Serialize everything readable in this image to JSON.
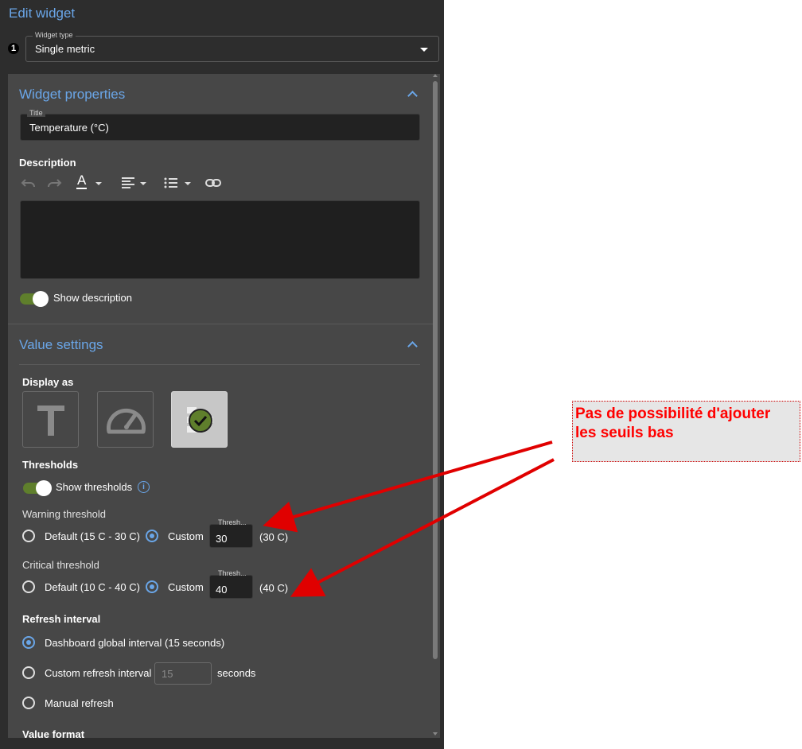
{
  "header": {
    "title": "Edit widget",
    "step_number": "1"
  },
  "widget_type": {
    "label": "Widget type",
    "value": "Single metric"
  },
  "widget_properties": {
    "title": "Widget properties",
    "title_field": {
      "label": "Title",
      "value": "Temperature (°C)"
    },
    "description_label": "Description",
    "toolbar": {
      "undo_icon": "undo-icon",
      "redo_icon": "redo-icon",
      "text_color_glyph": "A",
      "align_icon": "align-left-icon",
      "list_icon": "bulleted-list-icon",
      "link_icon": "link-icon"
    },
    "show_description_label": "Show description",
    "show_description_on": true
  },
  "value_settings": {
    "title": "Value settings",
    "display_as_label": "Display as",
    "display_options": [
      {
        "icon": "text-icon",
        "glyph": "T",
        "selected": false
      },
      {
        "icon": "gauge-icon",
        "selected": false
      },
      {
        "icon": "status-check-icon",
        "selected": true
      }
    ],
    "thresholds_label": "Thresholds",
    "show_thresholds_label": "Show thresholds",
    "show_thresholds_on": true,
    "warning": {
      "label": "Warning threshold",
      "default_label": "Default (15 C - 30 C)",
      "custom_label": "Custom",
      "field_label": "Thresh...",
      "value": "30",
      "unit_label": "(30 C)",
      "selected": "custom"
    },
    "critical": {
      "label": "Critical threshold",
      "default_label": "Default (10 C - 40 C)",
      "custom_label": "Custom",
      "field_label": "Thresh...",
      "value": "40",
      "unit_label": "(40 C)",
      "selected": "custom"
    },
    "refresh": {
      "label": "Refresh interval",
      "options": [
        {
          "label": "Dashboard global interval (15 seconds)",
          "selected": true
        },
        {
          "label": "Custom refresh interval",
          "selected": false
        },
        {
          "label": "Manual refresh",
          "selected": false
        }
      ],
      "custom_value": "15",
      "seconds_label": "seconds"
    },
    "value_format_label": "Value format"
  },
  "annotation": {
    "text": "Pas de possibilité d'ajouter\nles seuils bas",
    "color": "#ff0000"
  },
  "colors": {
    "accent": "#6aa6e8",
    "toggle_on": "#5f7f2c",
    "panel_bg": "#2d2d2d",
    "section_bg": "#474747"
  }
}
